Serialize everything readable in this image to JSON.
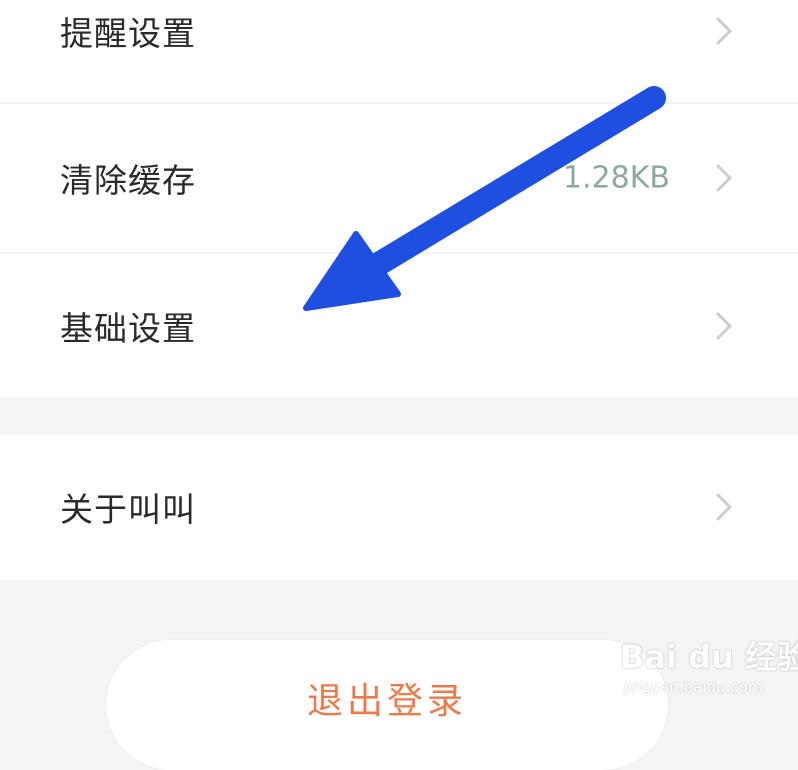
{
  "settings": {
    "items": [
      {
        "label": "提醒设置",
        "icon": "chevron-right-icon"
      },
      {
        "label": "清除缓存",
        "value": "1.28KB",
        "icon": "chevron-right-icon"
      },
      {
        "label": "基础设置",
        "icon": "chevron-right-icon"
      }
    ],
    "about": {
      "label": "关于叫叫",
      "icon": "chevron-right-icon"
    }
  },
  "logout": {
    "label": "退出登录",
    "color": "#ee7a4c"
  },
  "annotation": {
    "color": "#1f4fe0",
    "icon": "arrow-icon"
  },
  "watermark": {
    "text": "Bai du 经验",
    "url": "jingyan.baidu.com"
  },
  "colors": {
    "background": "#f3f4f6",
    "card": "#ffffff",
    "label": "#2a2a2a",
    "value": "#8fa6a6",
    "chevron": "#c9cdd2"
  }
}
